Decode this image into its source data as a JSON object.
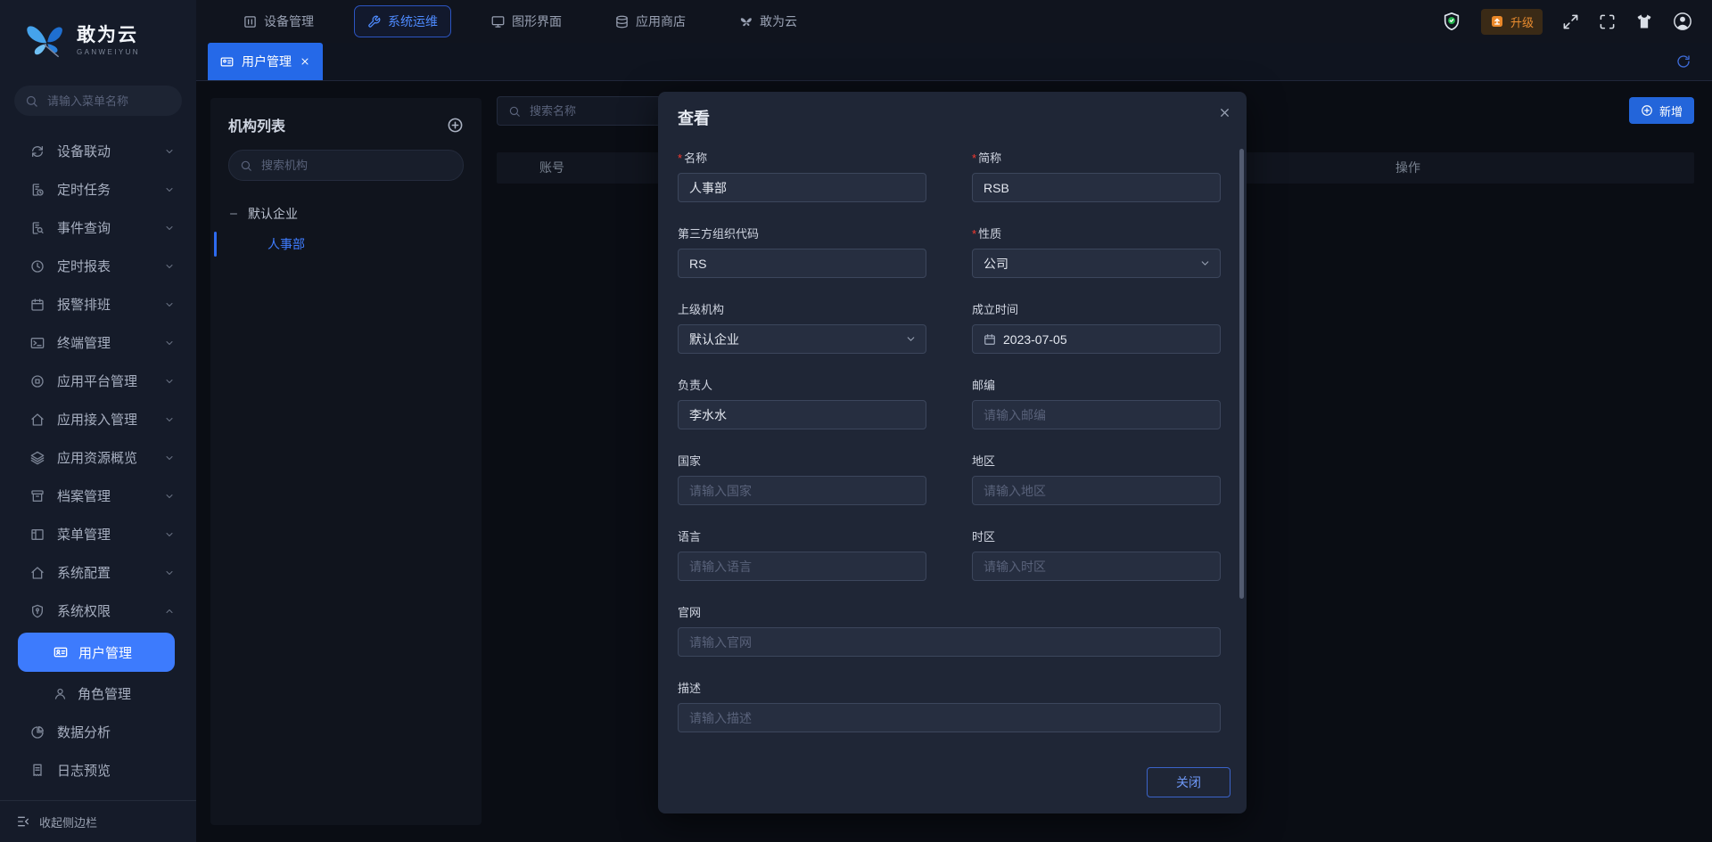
{
  "brand": {
    "name": "敢为云",
    "subtitle": "GANWEIYUN"
  },
  "topnav": {
    "items": [
      {
        "label": "设备管理",
        "icon": "bars-icon",
        "active": false
      },
      {
        "label": "系统运维",
        "icon": "wrench-icon",
        "active": true
      },
      {
        "label": "图形界面",
        "icon": "monitor-icon",
        "active": false
      },
      {
        "label": "应用商店",
        "icon": "database-icon",
        "active": false
      },
      {
        "label": "敢为云",
        "icon": "butterfly-icon",
        "active": false
      }
    ],
    "upgrade_label": "升级"
  },
  "tabbar": {
    "tabs": [
      {
        "label": "用户管理",
        "active": true
      }
    ]
  },
  "sidebar": {
    "search_placeholder": "请输入菜单名称",
    "items": [
      {
        "label": "设备联动",
        "icon": "sync-icon"
      },
      {
        "label": "定时任务",
        "icon": "doc-clock-icon"
      },
      {
        "label": "事件查询",
        "icon": "doc-search-icon"
      },
      {
        "label": "定时报表",
        "icon": "clock-icon"
      },
      {
        "label": "报警排班",
        "icon": "calendar-icon"
      },
      {
        "label": "终端管理",
        "icon": "terminal-icon"
      },
      {
        "label": "应用平台管理",
        "icon": "platform-icon"
      },
      {
        "label": "应用接入管理",
        "icon": "home-icon"
      },
      {
        "label": "应用资源概览",
        "icon": "layers-icon"
      },
      {
        "label": "档案管理",
        "icon": "archive-icon"
      },
      {
        "label": "菜单管理",
        "icon": "menu-board-icon"
      },
      {
        "label": "系统配置",
        "icon": "home-icon"
      },
      {
        "label": "系统权限",
        "icon": "shield-icon",
        "expanded": true,
        "children": [
          {
            "label": "用户管理",
            "active": true
          },
          {
            "label": "角色管理",
            "active": false
          }
        ]
      },
      {
        "label": "数据分析",
        "icon": "pie-icon"
      },
      {
        "label": "日志预览",
        "icon": "log-icon"
      }
    ],
    "collapse_label": "收起侧边栏"
  },
  "org_panel": {
    "title": "机构列表",
    "search_placeholder": "搜索机构",
    "tree": [
      {
        "label": "默认企业",
        "expanded": true,
        "children": [
          {
            "label": "人事部",
            "selected": true
          }
        ]
      }
    ]
  },
  "content": {
    "search_placeholder": "搜索名称",
    "add_button": "新增",
    "table_headers": [
      "账号",
      "操作"
    ]
  },
  "modal": {
    "title": "查看",
    "close_button": "关闭",
    "fields": [
      {
        "label": "名称",
        "required": true,
        "type": "text",
        "value": "人事部"
      },
      {
        "label": "简称",
        "required": true,
        "type": "text",
        "value": "RSB"
      },
      {
        "label": "第三方组织代码",
        "type": "text",
        "value": "RS"
      },
      {
        "label": "性质",
        "required": true,
        "type": "select",
        "value": "公司"
      },
      {
        "label": "上级机构",
        "type": "select",
        "value": "默认企业"
      },
      {
        "label": "成立时间",
        "type": "date",
        "value": "2023-07-05"
      },
      {
        "label": "负责人",
        "type": "text",
        "value": "李水水"
      },
      {
        "label": "邮编",
        "type": "text",
        "placeholder": "请输入邮编"
      },
      {
        "label": "国家",
        "type": "text",
        "placeholder": "请输入国家"
      },
      {
        "label": "地区",
        "type": "text",
        "placeholder": "请输入地区"
      },
      {
        "label": "语言",
        "type": "text",
        "placeholder": "请输入语言"
      },
      {
        "label": "时区",
        "type": "text",
        "placeholder": "请输入时区"
      },
      {
        "label": "官网",
        "type": "text",
        "placeholder": "请输入官网",
        "full": true
      },
      {
        "label": "描述",
        "type": "text",
        "placeholder": "请输入描述",
        "full": true
      }
    ]
  },
  "colors": {
    "accent_blue": "#3d7bfd",
    "tab_blue": "#2569e8",
    "upgrade_orange": "#e98c2f",
    "shield_green": "#22b24c",
    "required_red": "#f5392f",
    "selected_tree": "#3f7dff"
  }
}
